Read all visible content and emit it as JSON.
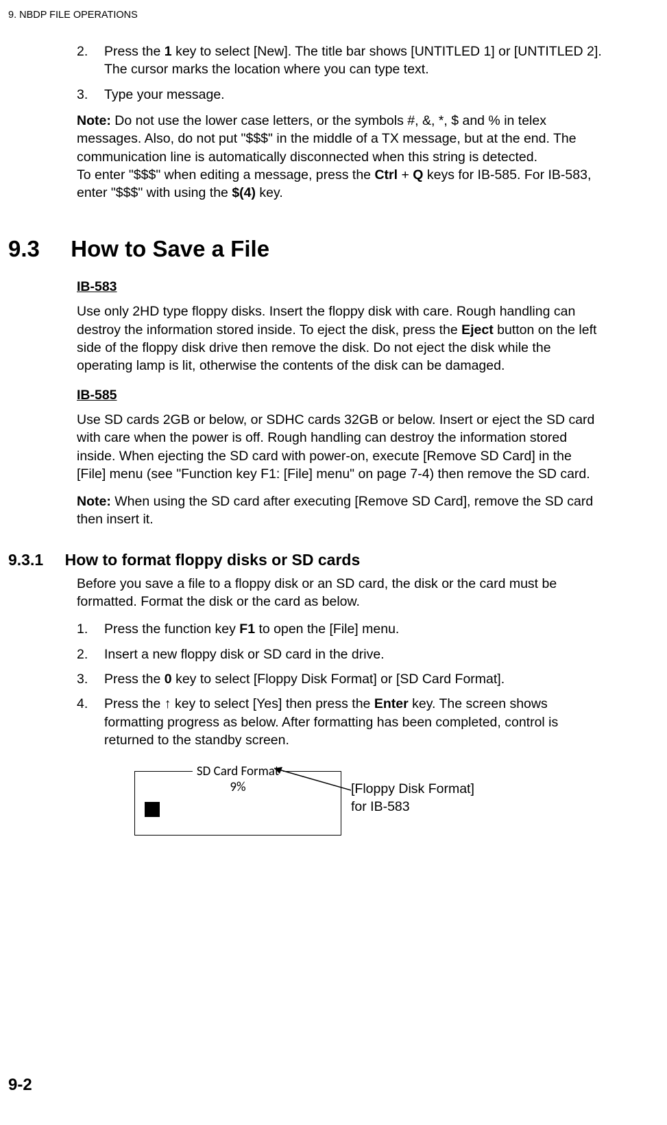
{
  "runningHead": "9.  NBDP FILE OPERATIONS",
  "stepsTop": [
    {
      "num": "2.",
      "html": "Press the <b>1</b> key to select [New]. The title bar shows [UNTITLED 1] or [UNTITLED 2]. The cursor marks the location where you can type text."
    },
    {
      "num": "3.",
      "html": "Type your message."
    }
  ],
  "noteTop": "<b>Note:</b> Do not use the lower case letters, or the symbols #, &, *, $ and % in telex messages. Also, do not put \"$$$\" in the middle of a TX message, but at the end. The communication line is automatically disconnected when this string is detected.<br>To enter \"$$$\" when editing a message, press the <b>Ctrl</b> + <b>Q</b> keys for IB-585. For IB-583, enter \"$$$\" with using the <b>$(4)</b> key.",
  "section": {
    "num": "9.3",
    "title": "How to Save a File"
  },
  "ib583": {
    "head": "IB-583",
    "body": "Use only 2HD type floppy disks. Insert the floppy disk with care. Rough handling can destroy the information stored inside. To eject the disk, press the <b>Eject</b> button on the left side of the floppy disk drive then remove the disk. Do not eject the disk while the operating lamp is lit, otherwise the contents of the disk can be damaged."
  },
  "ib585": {
    "head": "IB-585",
    "body": "Use SD cards 2GB or below, or SDHC cards 32GB or below. Insert or eject the SD card with care when the power is off. Rough handling can destroy the information stored inside. When ejecting the SD card with power-on, execute [Remove SD Card] in the [File] menu (see \"Function key F1: [File] menu\" on page 7-4) then remove the SD card.",
    "note": "<b>Note:</b> When using the SD card after executing [Remove SD Card], remove the SD card then insert it."
  },
  "subsection": {
    "num": "9.3.1",
    "title": "How to format floppy disks or SD cards",
    "intro": "Before you save a file to a floppy disk or an SD card, the disk or the card must be formatted. Format the disk or the card as below."
  },
  "stepsFormat": [
    {
      "num": "1.",
      "html": "Press the function key <b>F1</b> to open the [File] menu."
    },
    {
      "num": "2.",
      "html": "Insert a new floppy disk or SD card in the drive."
    },
    {
      "num": "3.",
      "html": "Press the <b>0</b> key to select [Floppy Disk Format] or [SD Card Format]."
    },
    {
      "num": "4.",
      "html": "Press the ↑ key to select [Yes] then press the <b>Enter</b> key. The screen shows formatting progress as below. After formatting has been completed, control is returned to the standby screen."
    }
  ],
  "figure": {
    "boxTitle": "SD Card Format",
    "percent": "9%",
    "callout1": "[Floppy Disk Format]",
    "callout2": "for IB-583"
  },
  "pageNum": "9-2"
}
